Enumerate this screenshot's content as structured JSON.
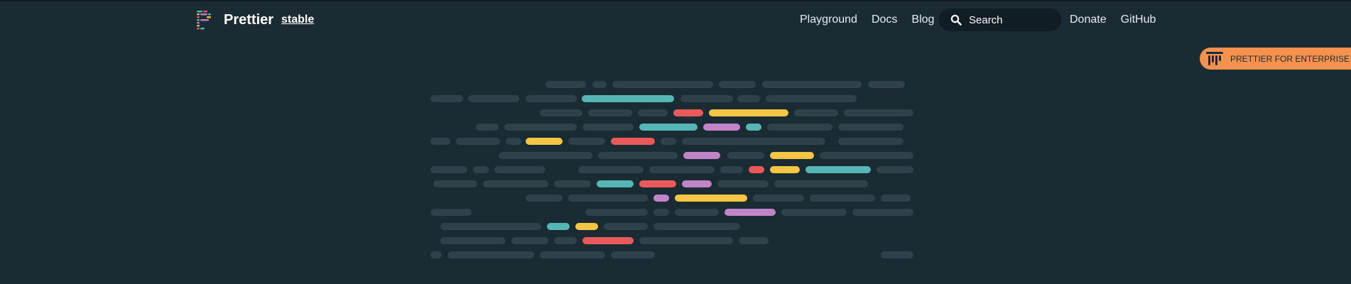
{
  "navbar": {
    "brand": "Prettier",
    "version": "stable",
    "links": [
      {
        "label": "Playground"
      },
      {
        "label": "Docs"
      },
      {
        "label": "Blog"
      }
    ],
    "search": {
      "placeholder": "Search"
    },
    "links_after_search": [
      {
        "label": "Donate"
      },
      {
        "label": "GitHub"
      }
    ]
  },
  "enterprise_badge": {
    "label": "PRETTIER FOR ENTERPRISE"
  },
  "colors": {
    "background": "#1a2b34",
    "code_gray": "#2f414b",
    "teal": "#56b6b6",
    "yellow": "#f7c545",
    "red": "#ea5a5a",
    "purple": "#c185c7",
    "badge": "#f7924e"
  },
  "icons": [
    "prettier-logo-icon",
    "search-icon",
    "enterprise-logo-icon"
  ]
}
